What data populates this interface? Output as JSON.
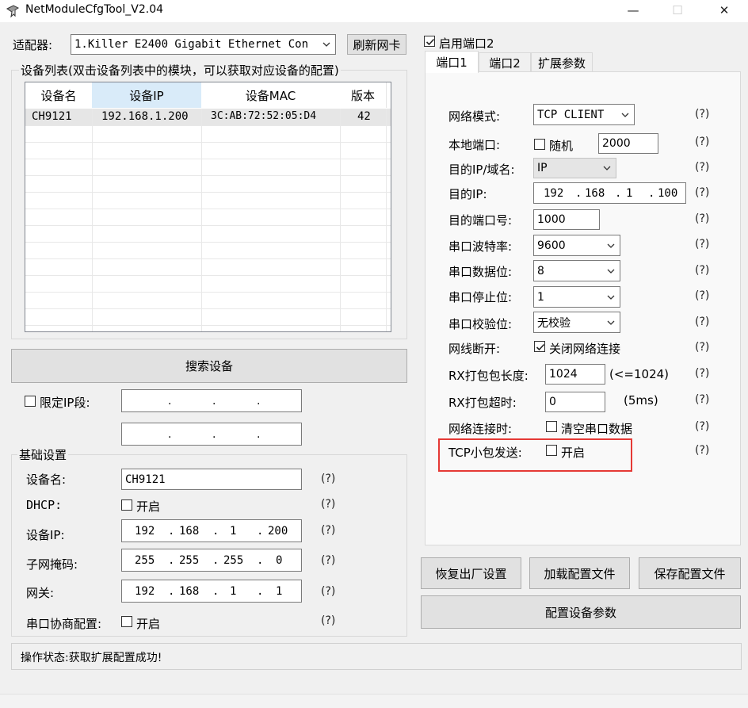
{
  "window": {
    "title": "NetModuleCfgTool_V2.04",
    "minimize": "—",
    "maximize": "☐",
    "close": "✕"
  },
  "adapter": {
    "label": "适配器:",
    "value": "1.Killer E2400 Gigabit Ethernet Con",
    "refresh": "刷新网卡"
  },
  "device_list": {
    "title": "设备列表(双击设备列表中的模块，可以获取对应设备的配置)",
    "columns": [
      "设备名",
      "设备IP",
      "设备MAC",
      "版本"
    ],
    "rows": [
      [
        "CH9121",
        "192.168.1.200",
        "3C:AB:72:52:05:D4",
        "42"
      ]
    ]
  },
  "search_button": "搜索设备",
  "ip_limit": {
    "label": "限定IP段:",
    "dots": ".",
    "checked": false
  },
  "basic": {
    "title": "基础设置",
    "device_name_label": "设备名:",
    "device_name": "CH9121",
    "dhcp_label": "DHCP:",
    "dhcp_enable": "开启",
    "device_ip_label": "设备IP:",
    "device_ip": [
      "192",
      "168",
      "1",
      "200"
    ],
    "mask_label": "子网掩码:",
    "mask": [
      "255",
      "255",
      "255",
      "0"
    ],
    "gateway_label": "网关:",
    "gateway": [
      "192",
      "168",
      "1",
      "1"
    ],
    "serial_neg_label": "串口协商配置:",
    "serial_neg_enable": "开启",
    "help": "(?)"
  },
  "status": {
    "text": "操作状态:获取扩展配置成功!"
  },
  "port2_enable": {
    "label": "启用端口2",
    "checked": true
  },
  "tabs": [
    {
      "label": "端口1"
    },
    {
      "label": "端口2"
    },
    {
      "label": "扩展参数"
    }
  ],
  "port": {
    "net_mode_label": "网络模式:",
    "net_mode": "TCP CLIENT",
    "local_port_label": "本地端口:",
    "random_label": "随机",
    "local_port": "2000",
    "dest_type_label": "目的IP/域名:",
    "dest_type": "IP",
    "dest_ip_label": "目的IP:",
    "dest_ip": [
      "192",
      "168",
      "1",
      "100"
    ],
    "dest_port_label": "目的端口号:",
    "dest_port": "1000",
    "baud_label": "串口波特率:",
    "baud": "9600",
    "databits_label": "串口数据位:",
    "databits": "8",
    "stopbits_label": "串口停止位:",
    "stopbits": "1",
    "parity_label": "串口校验位:",
    "parity": "无校验",
    "disconnect_label": "网线断开:",
    "close_conn_label": "关闭网络连接",
    "rx_len_label": "RX打包包长度:",
    "rx_len": "1024",
    "rx_len_hint": "(<=1024)",
    "rx_timeout_label": "RX打包超时:",
    "rx_timeout": "0",
    "rx_timeout_hint": "(5ms)",
    "net_conn_label": "网络连接时:",
    "clear_serial_label": "清空串口数据",
    "tcp_small_label": "TCP小包发送:",
    "tcp_small_enable": "开启",
    "help": "(?)"
  },
  "actions": {
    "factory": "恢复出厂设置",
    "load": "加载配置文件",
    "save": "保存配置文件",
    "apply": "配置设备参数"
  },
  "colors": {
    "highlight": "#e53935",
    "header_selected": "#d9ebf9",
    "row_selected": "#e6e6e6"
  }
}
